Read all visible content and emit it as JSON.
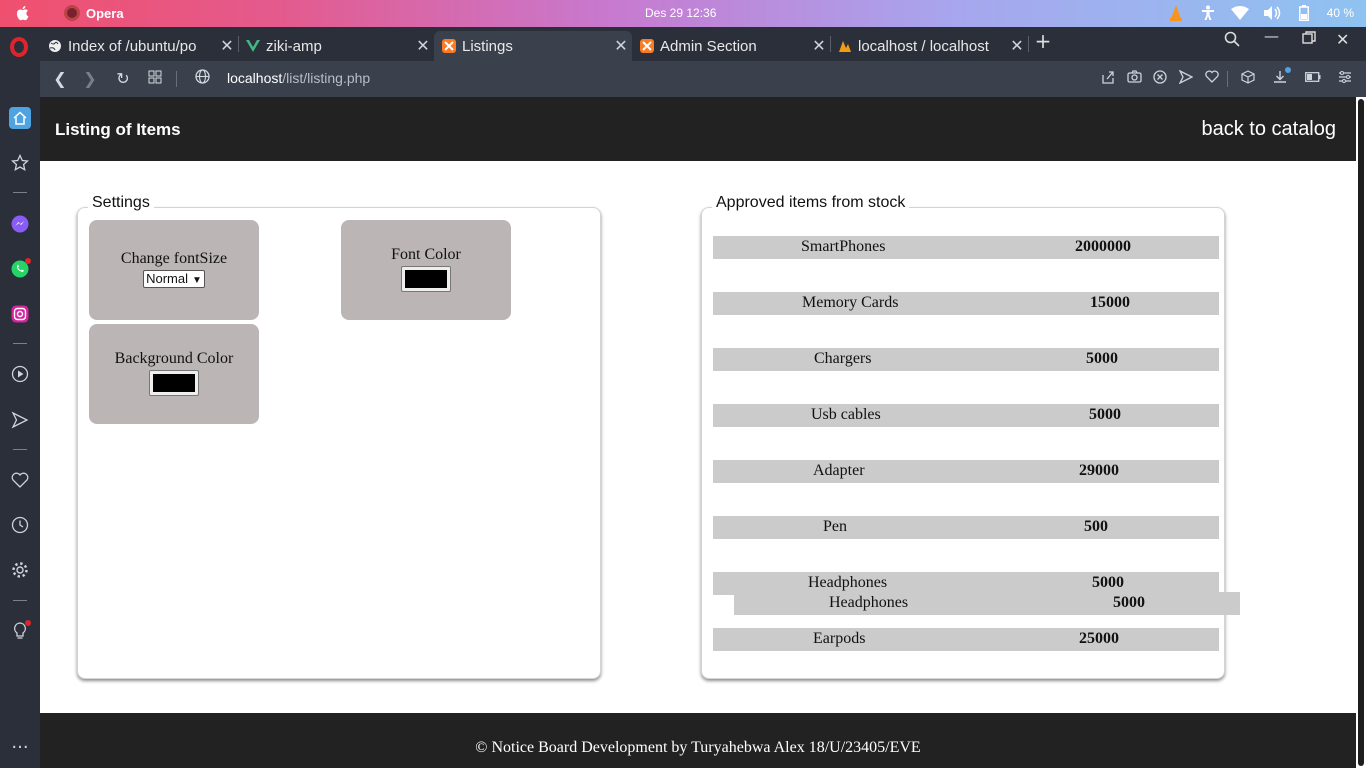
{
  "os": {
    "app_name": "Opera",
    "clock": "Des 29  12:36",
    "battery": "40 %"
  },
  "tabs": [
    {
      "label": "Index of /ubuntu/po",
      "icon": "globe-icon"
    },
    {
      "label": "ziki-amp",
      "icon": "vue-icon"
    },
    {
      "label": "Listings",
      "icon": "xampp-icon",
      "active": true
    },
    {
      "label": "Admin Section",
      "icon": "xampp-icon"
    },
    {
      "label": "localhost / localhost",
      "icon": "phpmyadmin-icon"
    }
  ],
  "address": {
    "host": "localhost",
    "path": "/list/listing.php"
  },
  "header": {
    "title": "Listing of Items",
    "back_link": "back to catalog"
  },
  "settings": {
    "legend": "Settings",
    "font_size_label": "Change fontSize",
    "font_size_value": "Normal",
    "font_color_label": "Font Color",
    "font_color_value": "#000000",
    "bg_color_label": "Background Color",
    "bg_color_value": "#000000"
  },
  "stock": {
    "legend": "Approved items from stock",
    "items": [
      {
        "name": "SmartPhones",
        "qty": "2000000"
      },
      {
        "name": "Memory Cards",
        "qty": "15000"
      },
      {
        "name": "Chargers",
        "qty": "5000"
      },
      {
        "name": "Usb cables",
        "qty": "5000"
      },
      {
        "name": "Adapter",
        "qty": "29000"
      },
      {
        "name": "Pen",
        "qty": "500"
      },
      {
        "name": "Headphones",
        "qty": "5000"
      },
      {
        "name": "Earpods",
        "qty": "25000"
      }
    ],
    "dragging": {
      "name": "Headphones",
      "qty": "5000"
    }
  },
  "footer": {
    "text": "© Notice Board Development by Turyahebwa Alex 18/U/23405/EVE"
  },
  "colors": {
    "header_bg": "#222222",
    "box_bg": "#bcb5b5",
    "row_bg": "#cbcbcb",
    "accent": "#4fa3e0"
  }
}
